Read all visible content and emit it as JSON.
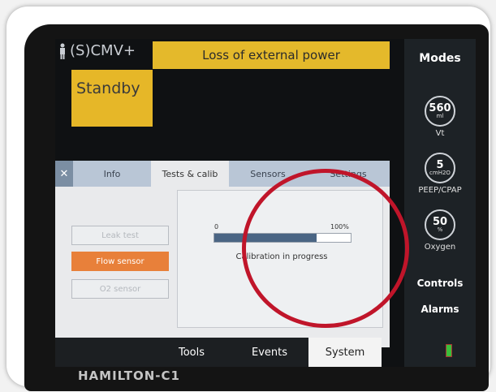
{
  "header": {
    "mode_label": "(S)CMV+",
    "alarm_text": "Loss of external power",
    "status": "Standby"
  },
  "side": {
    "modes_label": "Modes",
    "params": [
      {
        "value": "560",
        "unit": "ml",
        "label": "Vt"
      },
      {
        "value": "5",
        "unit": "cmH2O",
        "label": "PEEP/CPAP"
      },
      {
        "value": "50",
        "unit": "%",
        "label": "Oxygen"
      }
    ],
    "controls_label": "Controls",
    "alarms_label": "Alarms"
  },
  "dialog": {
    "tabs": [
      "Info",
      "Tests & calib",
      "Sensors",
      "Settings"
    ],
    "active_tab": "Tests & calib",
    "buttons": [
      "Leak test",
      "Flow sensor",
      "O2 sensor"
    ],
    "progress": {
      "min_label": "0",
      "max_label": "100%",
      "value_percent": 75,
      "status_text": "Calibration in progress"
    }
  },
  "bottom_tabs": [
    "Tools",
    "Events",
    "System"
  ],
  "brand": "HAMILTON-C1",
  "colors": {
    "alarm": "#e4b92b",
    "accent": "#e8803a",
    "progress": "#4a6584",
    "highlight_circle": "#c0152a"
  }
}
